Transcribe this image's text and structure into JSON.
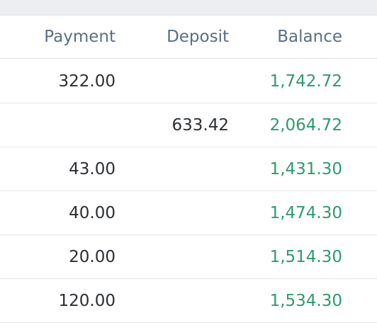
{
  "table": {
    "headers": {
      "payment": "Payment",
      "deposit": "Deposit",
      "balance": "Balance"
    },
    "rows": [
      {
        "payment": "322.00",
        "deposit": "",
        "balance": "1,742.72"
      },
      {
        "payment": "",
        "deposit": "633.42",
        "balance": "2,064.72"
      },
      {
        "payment": "43.00",
        "deposit": "",
        "balance": "1,431.30"
      },
      {
        "payment": "40.00",
        "deposit": "",
        "balance": "1,474.30"
      },
      {
        "payment": "20.00",
        "deposit": "",
        "balance": "1,514.30"
      },
      {
        "payment": "120.00",
        "deposit": "",
        "balance": "1,534.30"
      }
    ]
  },
  "colors": {
    "header_text": "#5a6e84",
    "amount_text": "#2b2f33",
    "balance_text": "#2e9a6e",
    "toolbar_bg": "#eceef1"
  }
}
